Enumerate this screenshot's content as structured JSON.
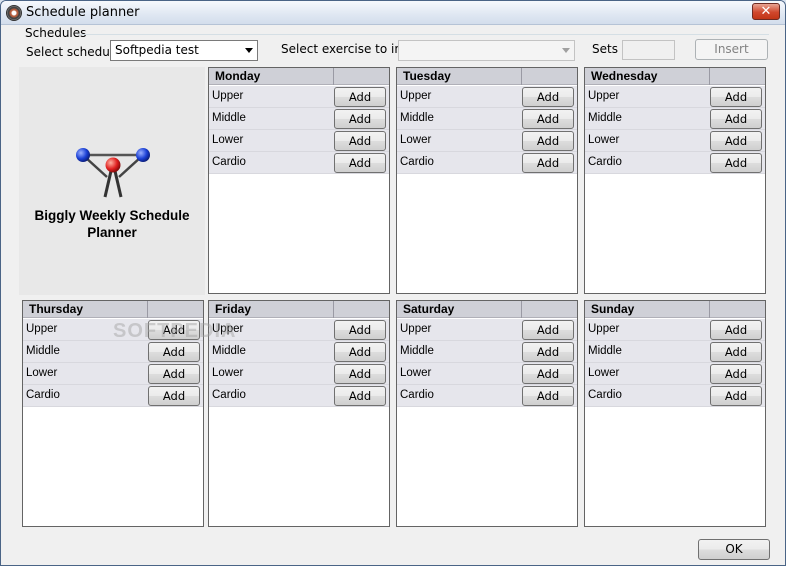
{
  "window": {
    "title": "Schedule planner"
  },
  "schedules": {
    "group_label": "Schedules",
    "select_schedule_label": "Select schedule",
    "selected_schedule": "Softpedia test",
    "select_exercise_label": "Select exercise to insert",
    "selected_exercise": "",
    "sets_label": "Sets",
    "sets_value": "",
    "insert_label": "Insert"
  },
  "logo": {
    "title_line1": "Biggly Weekly Schedule",
    "title_line2": "Planner"
  },
  "add_label": "Add",
  "days": [
    {
      "name": "Monday",
      "rows": [
        "Upper",
        "Middle",
        "Lower",
        "Cardio"
      ]
    },
    {
      "name": "Tuesday",
      "rows": [
        "Upper",
        "Middle",
        "Lower",
        "Cardio"
      ]
    },
    {
      "name": "Wednesday",
      "rows": [
        "Upper",
        "Middle",
        "Lower",
        "Cardio"
      ]
    },
    {
      "name": "Thursday",
      "rows": [
        "Upper",
        "Middle",
        "Lower",
        "Cardio"
      ]
    },
    {
      "name": "Friday",
      "rows": [
        "Upper",
        "Middle",
        "Lower",
        "Cardio"
      ]
    },
    {
      "name": "Saturday",
      "rows": [
        "Upper",
        "Middle",
        "Lower",
        "Cardio"
      ]
    },
    {
      "name": "Sunday",
      "rows": [
        "Upper",
        "Middle",
        "Lower",
        "Cardio"
      ]
    }
  ],
  "ok_label": "OK",
  "watermark": "SOFTPEDIA",
  "colors": {
    "logo_ball_red": "#e02020",
    "logo_ball_blue": "#1a3fd4"
  }
}
